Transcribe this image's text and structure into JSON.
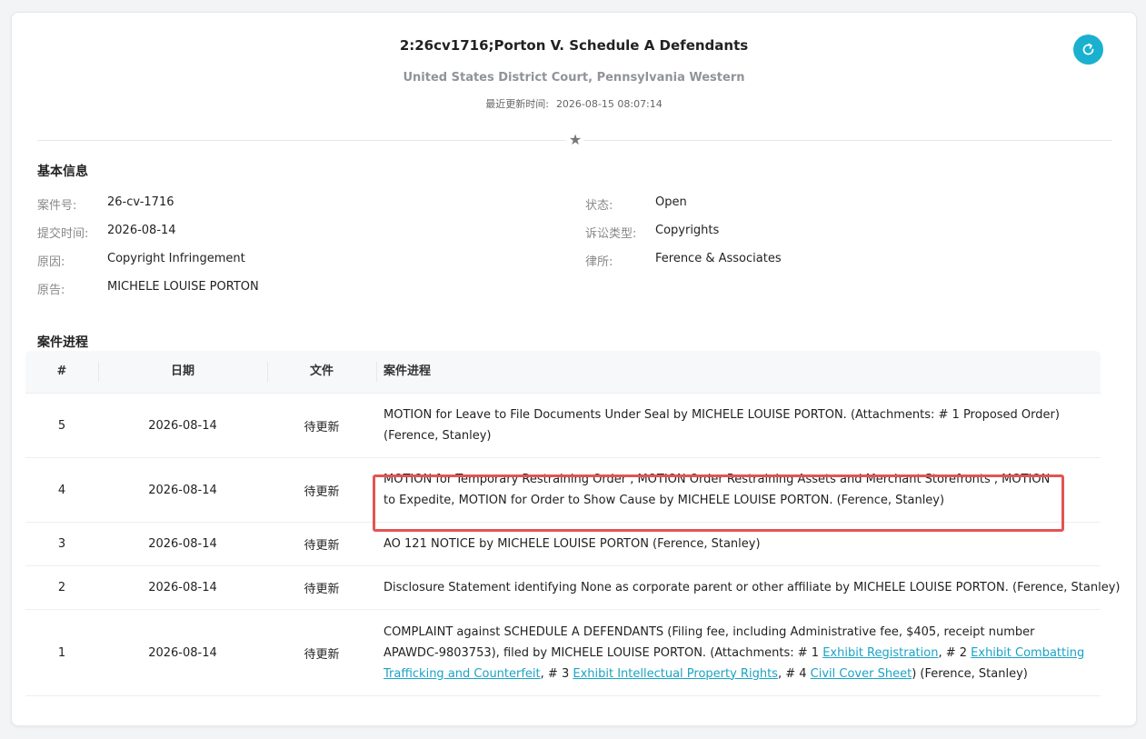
{
  "header": {
    "title": "2:26cv1716;Porton V. Schedule A Defendants",
    "court": "United States District Court, Pennsylvania Western",
    "updated_label": "最近更新时间:",
    "updated_value": "2026-08-15 08:07:14"
  },
  "basic": {
    "section_title": "基本信息",
    "left": [
      {
        "label": "案件号:",
        "value": "26-cv-1716"
      },
      {
        "label": "提交时间:",
        "value": "2026-08-14"
      },
      {
        "label": "原因:",
        "value": "Copyright Infringement"
      },
      {
        "label": "原告:",
        "value": "MICHELE LOUISE PORTON"
      }
    ],
    "right": [
      {
        "label": "状态:",
        "value": "Open"
      },
      {
        "label": "诉讼类型:",
        "value": "Copyrights"
      },
      {
        "label": "律所:",
        "value": "Ference & Associates"
      }
    ]
  },
  "progress": {
    "section_title": "案件进程",
    "columns": [
      "#",
      "日期",
      "文件",
      "案件进程"
    ],
    "rows": [
      {
        "num": "5",
        "date": "2026-08-14",
        "file": "待更新",
        "desc": "MOTION for Leave to File Documents Under Seal by MICHELE LOUISE PORTON. (Attachments: # 1 Proposed Order) (Ference, Stanley)"
      },
      {
        "num": "4",
        "date": "2026-08-14",
        "file": "待更新",
        "desc": "MOTION for Temporary Restraining Order , MOTION Order Restraining Assets and Merchant Storefronts , MOTION to Expedite, MOTION for Order to Show Cause by MICHELE LOUISE PORTON. (Ference, Stanley)"
      },
      {
        "num": "3",
        "date": "2026-08-14",
        "file": "待更新",
        "desc": "AO 121 NOTICE by MICHELE LOUISE PORTON (Ference, Stanley)"
      },
      {
        "num": "2",
        "date": "2026-08-14",
        "file": "待更新",
        "desc": "Disclosure Statement identifying None as corporate parent or other affiliate by MICHELE LOUISE PORTON. (Ference, Stanley)"
      },
      {
        "num": "1",
        "date": "2026-08-14",
        "file": "待更新",
        "desc_parts": {
          "p1": "COMPLAINT against SCHEDULE A DEFENDANTS (Filing fee, including Administrative fee, $405, receipt number APAWDC-9803753), filed by MICHELE LOUISE PORTON. (Attachments: # 1 ",
          "l1": "Exhibit Registration",
          "p2": ", # 2 ",
          "l2": "Exhibit Combatting Trafficking and Counterfeit",
          "p3": ", # 3 ",
          "l3": "Exhibit Intellectual Property Rights",
          "p4": ", # 4 ",
          "l4": "Civil Cover Sheet",
          "p5": ") (Ference, Stanley)"
        }
      }
    ]
  }
}
